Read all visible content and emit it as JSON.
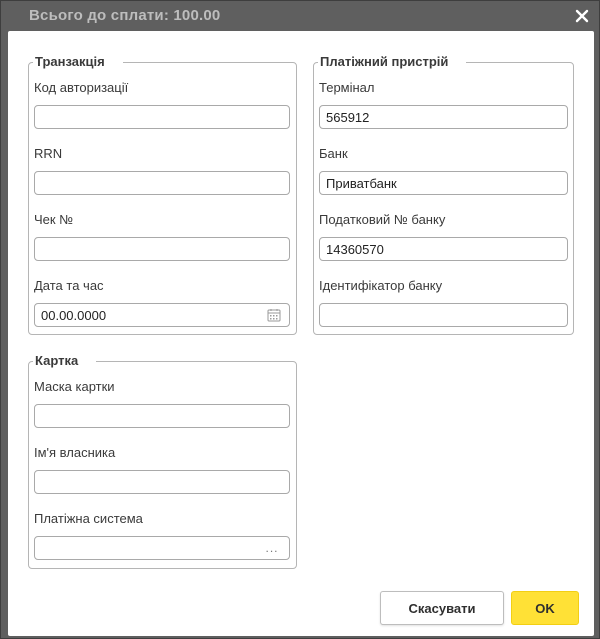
{
  "title": "Всього до сплати: 100.00",
  "close_icon": "close-icon",
  "transaction": {
    "legend": "Транзакція",
    "auth_code_label": "Код авторизації",
    "auth_code_value": "",
    "rrn_label": "RRN",
    "rrn_value": "",
    "receipt_label": "Чек №",
    "receipt_value": "",
    "datetime_label": "Дата та час",
    "datetime_value": "00.00.0000",
    "datetime_icon": "calendar-icon"
  },
  "device": {
    "legend": "Платіжний пристрій",
    "terminal_label": "Термінал",
    "terminal_value": "565912",
    "bank_label": "Банк",
    "bank_value": "Приватбанк",
    "bank_tax_label": "Податковий № банку",
    "bank_tax_value": "14360570",
    "bank_id_label": "Ідентифікатор банку",
    "bank_id_value": ""
  },
  "card": {
    "legend": "Картка",
    "mask_label": "Маска картки",
    "mask_value": "",
    "holder_label": "Ім'я власника",
    "holder_value": "",
    "system_label": "Платіжна система",
    "system_value": "",
    "system_icon": "ellipsis-icon",
    "system_button_text": "..."
  },
  "buttons": {
    "cancel": "Скасувати",
    "ok": "OK"
  },
  "colors": {
    "header_bg": "#5f5f5f",
    "title_text": "#bdbdbd",
    "ok_button": "#ffe136",
    "border": "#b5b5b5"
  }
}
